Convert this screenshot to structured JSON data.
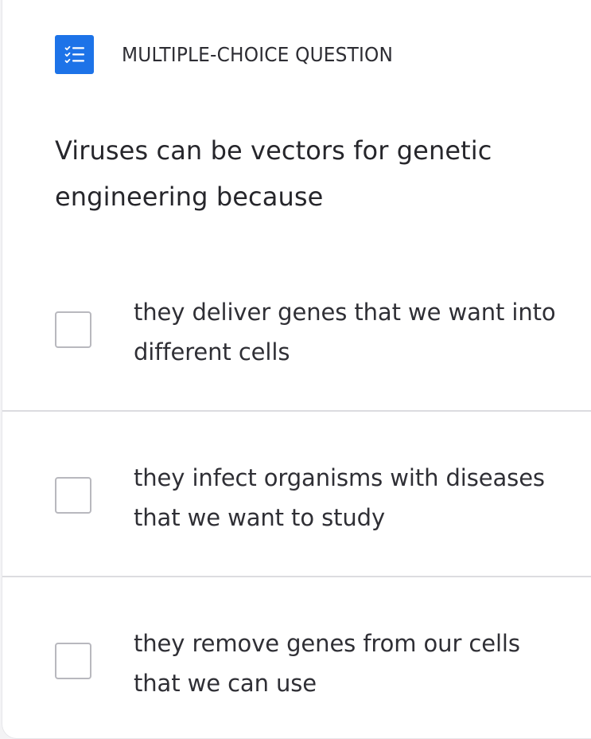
{
  "header": {
    "type_label": "MULTIPLE-CHOICE QUESTION",
    "icon": "checklist-icon",
    "accent_color": "#1d73e8"
  },
  "question": {
    "text": "Viruses can be vectors for genetic engineering because"
  },
  "options": [
    {
      "text": "they deliver genes that we want into different cells",
      "checked": false
    },
    {
      "text": "they infect organisms with diseases that we want to study",
      "checked": false
    },
    {
      "text": "they remove genes from our cells that we can use",
      "checked": false
    }
  ]
}
